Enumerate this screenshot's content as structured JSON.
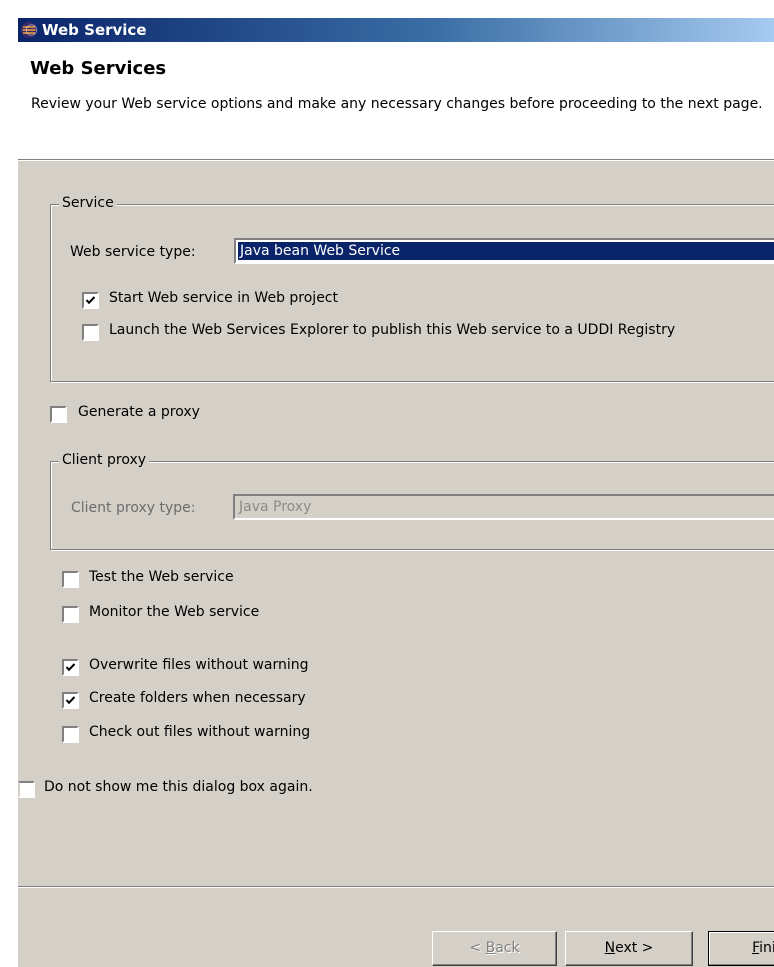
{
  "window": {
    "title": "Web Service"
  },
  "header": {
    "title": "Web Services",
    "description": "Review your Web service options and make any necessary changes before proceeding to the next page."
  },
  "service": {
    "legend": "Service",
    "type_label": "Web service type:",
    "type_value": "Java bean Web Service",
    "start_label": "Start Web service in Web project",
    "start_checked": true,
    "launch_label": "Launch the Web Services Explorer to publish this Web service to a UDDI Registry",
    "launch_checked": false
  },
  "generate_proxy": {
    "label": "Generate a proxy",
    "checked": false
  },
  "client_proxy": {
    "legend": "Client proxy",
    "type_label": "Client proxy type:",
    "type_value": "Java Proxy"
  },
  "options": [
    {
      "label": "Test the Web service",
      "checked": false
    },
    {
      "label": "Monitor the Web service",
      "checked": false
    },
    {
      "label": "Overwrite files without warning",
      "checked": true
    },
    {
      "label": "Create folders when necessary",
      "checked": true
    },
    {
      "label": "Check out files without warning",
      "checked": false
    }
  ],
  "dont_show": {
    "label": "Do not show me this dialog box again.",
    "checked": false
  },
  "buttons": {
    "back": {
      "mnemonic": "B",
      "rest": "ack",
      "prefix": "< "
    },
    "next": {
      "mnemonic": "N",
      "rest": "ext >"
    },
    "finish": {
      "mnemonic": "F",
      "rest": "inish"
    }
  }
}
